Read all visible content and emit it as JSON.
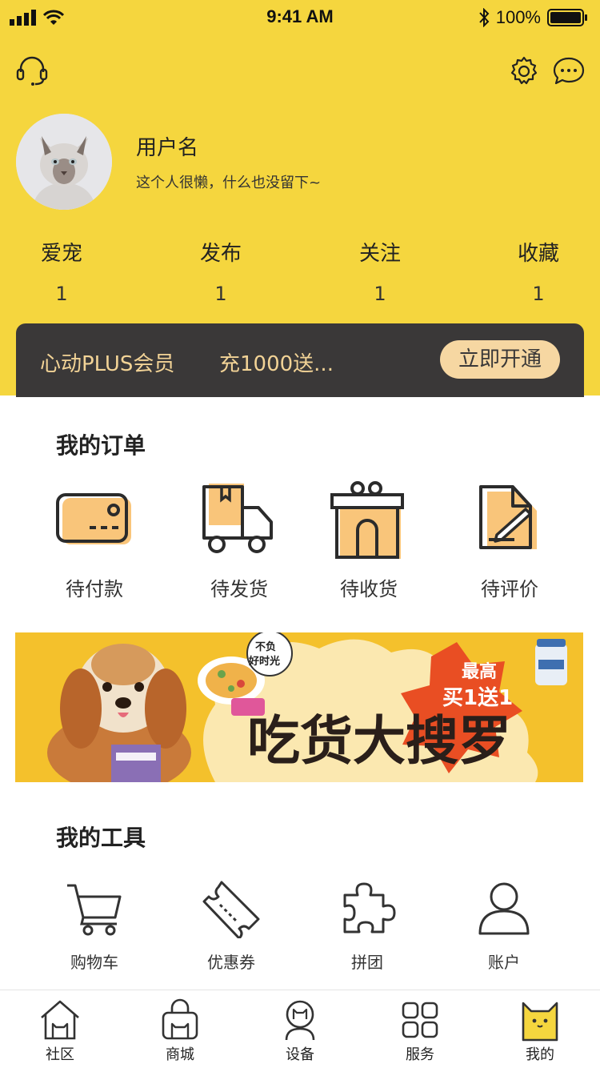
{
  "status_bar": {
    "time": "9:41 AM",
    "battery": "100%"
  },
  "profile": {
    "username": "用户名",
    "bio": "这个人很懒，什么也没留下~"
  },
  "stats": [
    {
      "label": "爱宠",
      "value": "1"
    },
    {
      "label": "发布",
      "value": "1"
    },
    {
      "label": "关注",
      "value": "1"
    },
    {
      "label": "收藏",
      "value": "1"
    }
  ],
  "vip": {
    "title": "心动PLUS会员",
    "promo": "充1000送...",
    "button": "立即开通"
  },
  "orders": {
    "title": "我的订单",
    "items": [
      {
        "label": "待付款",
        "icon": "card-icon"
      },
      {
        "label": "待发货",
        "icon": "truck-icon"
      },
      {
        "label": "待收货",
        "icon": "gift-box-icon"
      },
      {
        "label": "待评价",
        "icon": "review-icon"
      }
    ]
  },
  "banner": {
    "headline": "吃货大搜罗",
    "badge_line1": "最高",
    "badge_line2": "买1送1",
    "tag": "不负好时光"
  },
  "tools": {
    "title": "我的工具",
    "items": [
      {
        "label": "购物车",
        "icon": "cart-icon"
      },
      {
        "label": "优惠券",
        "icon": "coupon-icon"
      },
      {
        "label": "拼团",
        "icon": "puzzle-icon"
      },
      {
        "label": "账户",
        "icon": "user-icon"
      }
    ]
  },
  "tabbar": {
    "items": [
      {
        "label": "社区",
        "icon": "house-cat-icon"
      },
      {
        "label": "商城",
        "icon": "bag-cat-icon"
      },
      {
        "label": "设备",
        "icon": "device-cat-icon"
      },
      {
        "label": "服务",
        "icon": "grid-cat-icon"
      },
      {
        "label": "我的",
        "icon": "cat-face-icon",
        "active": true
      }
    ]
  },
  "colors": {
    "brand_yellow": "#F5D63E",
    "accent_orange": "#F9C57A",
    "vip_bg": "#3A3838",
    "vip_gold": "#F2D396"
  }
}
